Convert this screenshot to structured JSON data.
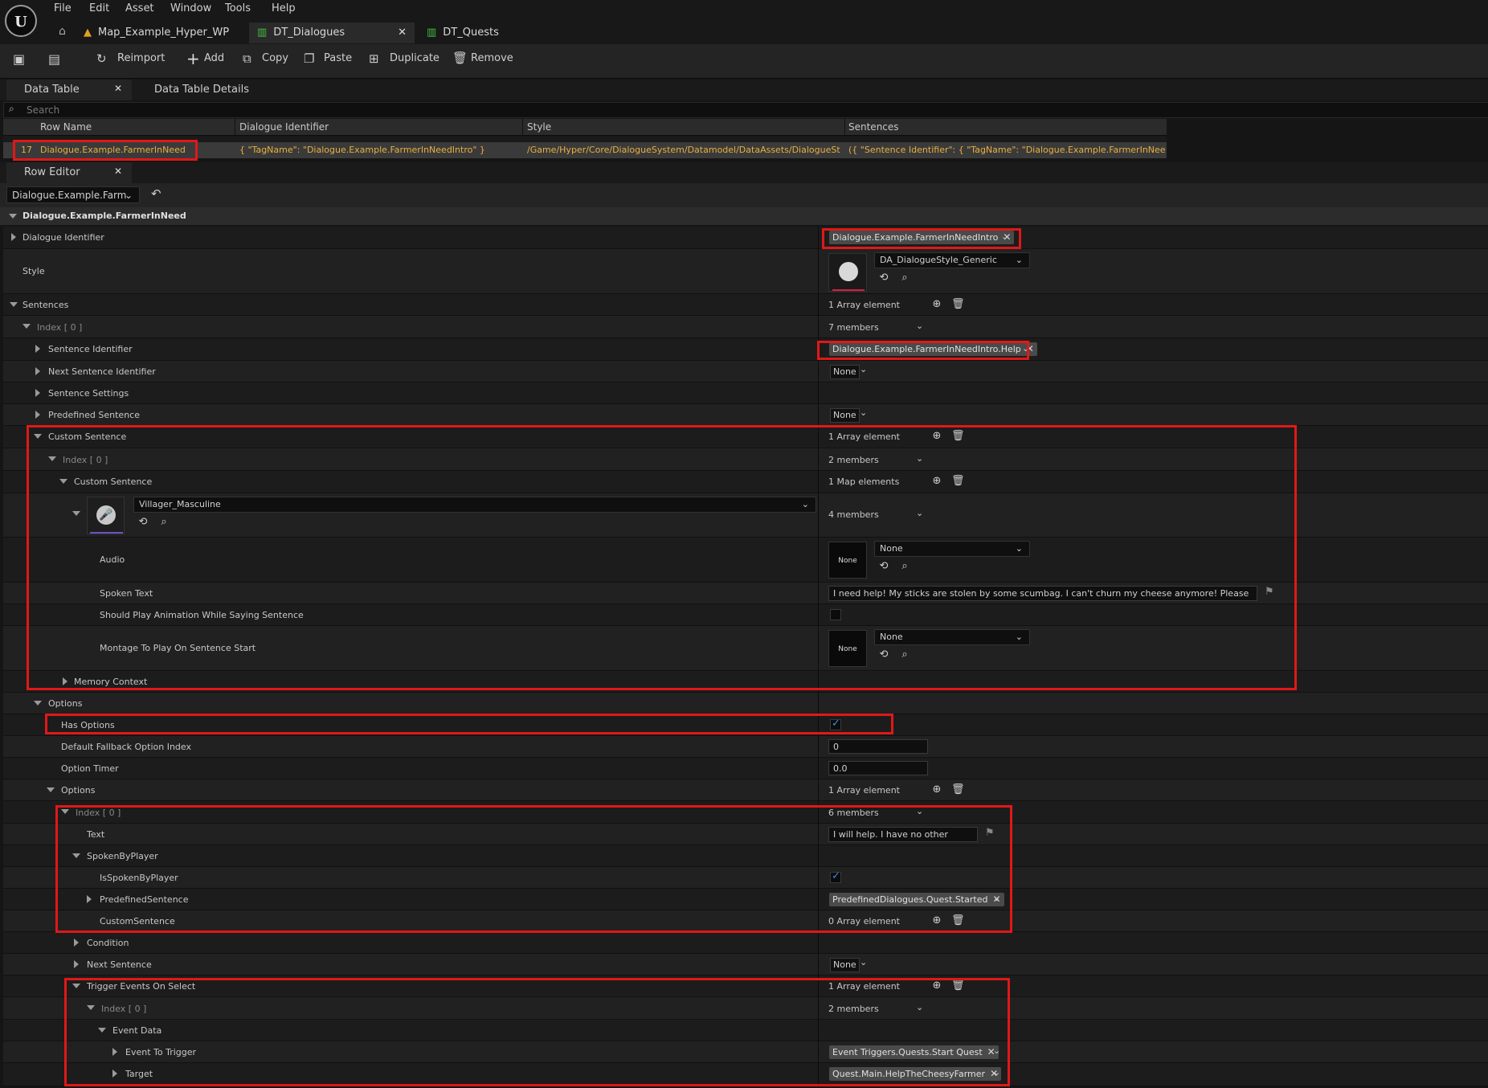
{
  "menu": [
    "File",
    "Edit",
    "Asset",
    "Window",
    "Tools",
    "Help"
  ],
  "doc_tabs": [
    "Map_Example_Hyper_WP",
    "DT_Dialogues",
    "DT_Quests"
  ],
  "toolbar": {
    "reimport": "Reimport",
    "add": "Add",
    "copy": "Copy",
    "paste": "Paste",
    "duplicate": "Duplicate",
    "remove": "Remove"
  },
  "panel_tabs": {
    "data_table": "Data Table",
    "data_table_details": "Data Table Details",
    "row_editor": "Row Editor"
  },
  "search_placeholder": "Search",
  "table": {
    "columns": [
      "Row Name",
      "Dialogue Identifier",
      "Style",
      "Sentences"
    ],
    "row": {
      "index": "17",
      "name": "Dialogue.Example.FarmerInNeed",
      "identifier": "{ \"TagName\": \"Dialogue.Example.FarmerInNeedIntro\" }",
      "style": "/Game/Hyper/Core/DialogueSystem/Datamodel/DataAssets/DialogueSty",
      "sentences": "({ \"Sentence Identifier\": { \"TagName\": \"Dialogue.Example.FarmerInNeedIntr"
    }
  },
  "row_editor": {
    "row_select": "Dialogue.Example.Farm",
    "header": "Dialogue.Example.FarmerInNeed",
    "labels": {
      "dialogue_identifier": "Dialogue Identifier",
      "style": "Style",
      "sentences": "Sentences",
      "index0": "Index [ 0 ]",
      "sentence_identifier": "Sentence Identifier",
      "next_sentence_identifier": "Next Sentence Identifier",
      "sentence_settings": "Sentence Settings",
      "predefined_sentence": "Predefined Sentence",
      "custom_sentence": "Custom Sentence",
      "audio": "Audio",
      "spoken_text": "Spoken Text",
      "should_play_anim": "Should Play Animation While Saying Sentence",
      "montage": "Montage To Play On Sentence Start",
      "memory_context": "Memory Context",
      "options": "Options",
      "has_options": "Has Options",
      "default_fallback": "Default Fallback Option Index",
      "option_timer": "Option Timer",
      "text": "Text",
      "spoken_by_player": "SpokenByPlayer",
      "is_spoken_by_player": "IsSpokenByPlayer",
      "predefined_sentence2": "PredefinedSentence",
      "custom_sentence2": "CustomSentence",
      "condition": "Condition",
      "next_sentence": "Next Sentence",
      "trigger_events": "Trigger Events On Select",
      "event_data": "Event Data",
      "event_to_trigger": "Event To Trigger",
      "target": "Target"
    },
    "values": {
      "dialogue_identifier_tag": "Dialogue.Example.FarmerInNeedIntro",
      "style_asset": "DA_DialogueStyle_Generic",
      "one_array": "1 Array element",
      "zero_array": "0 Array element",
      "seven_members": "7 members",
      "two_members": "2 members",
      "four_members": "4 members",
      "six_members": "6 members",
      "one_map": "1 Map elements",
      "sentence_identifier_tag": "Dialogue.Example.FarmerInNeedIntro.Help",
      "none": "None",
      "voice": "Villager_Masculine",
      "spoken_text": "I need help! My sticks are stolen by some scumbag. I can't churn my cheese anymore! Please help me.",
      "default_fallback": "0",
      "option_timer": "0.0",
      "option_text": "I will help. I have no other option!",
      "predefined_tag": "PredefinedDialogues.Quest.Started",
      "event_tag": "Event Triggers.Quests.Start Quest",
      "target_tag": "Quest.Main.HelpTheCheesyFarmer"
    },
    "checks": {
      "should_play_anim": false,
      "has_options": true,
      "is_spoken_by_player": true
    }
  },
  "colors": {
    "highlight_red": "#e01818",
    "row_text": "#e8b040",
    "check_blue": "#3a8ee8"
  }
}
